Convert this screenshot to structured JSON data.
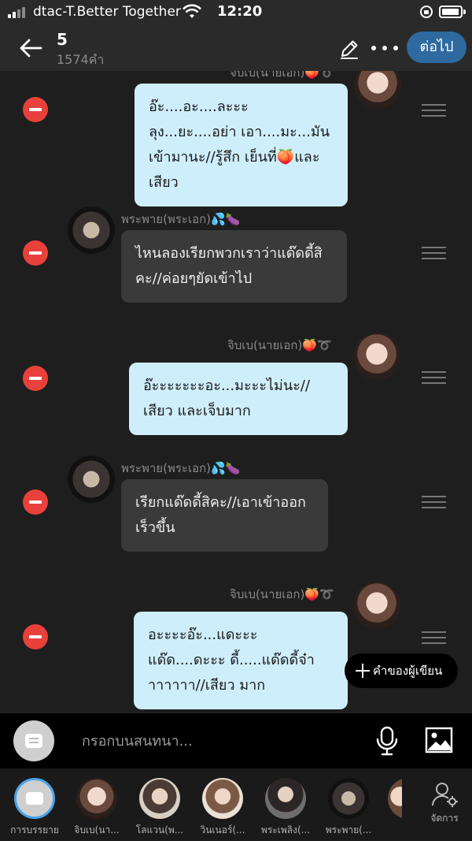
{
  "status_bar": {
    "carrier": "dtac-T.Better Together",
    "time": "12:20"
  },
  "header": {
    "title": "5",
    "word_count": "1574คำ",
    "next_label": "ต่อไป"
  },
  "messages": [
    {
      "side": "right",
      "sender": "จิบเบ(นายเอก)🍑➰",
      "text": "อ๊ะ....อะ....ละะะลุง...ยะ....อย่า เอา....มะ...มันเข้ามานะ//รู้สึก เย็นที่🍑และเสียว"
    },
    {
      "side": "left",
      "sender": "พระพาย(พระเอก)💦🍆",
      "text": "ไหนลองเรียกพวกเราว่าแด๊ดดี้สิ คะ//ค่อยๆยัดเข้าไป"
    },
    {
      "side": "right",
      "sender": "จิบเบ(นายเอก)🍑➰",
      "text": "อ๊ะะะะะะะอะ...มะะะไม่นะ//เสียว และเจ็บมาก"
    },
    {
      "side": "left",
      "sender": "พระพาย(พระเอก)💦🍆",
      "text": "เรียกแด๊ดดี้สิคะ//เอาเข้าออก เร็วขึ้น"
    },
    {
      "side": "right",
      "sender": "จิบเบ(นายเอก)🍑➰",
      "text": "อะะะะอ๊ะ...แดะะะแด๊ด....ดะะะ ดี้.....แด๊ดดี้จ๋าาาาาาา//เสียว มาก"
    }
  ],
  "writer_button": "คำของผู้เขียน",
  "input": {
    "placeholder": "กรอกบนสนทนา..."
  },
  "characters": [
    {
      "label": "การบรรยาย"
    },
    {
      "label": "จิบเบ(นา..."
    },
    {
      "label": "โลแวน(พ..."
    },
    {
      "label": "วินเนอร์(..."
    },
    {
      "label": "พระเพลิง(..."
    },
    {
      "label": "พระพาย(..."
    }
  ],
  "manage_label": "จัดการ",
  "colors": {
    "background": "#1e1e1e",
    "accent": "#2e6a9f",
    "delete": "#e8413b",
    "bubble_right": "#cfeefb",
    "bubble_left": "#3a3a3a"
  }
}
